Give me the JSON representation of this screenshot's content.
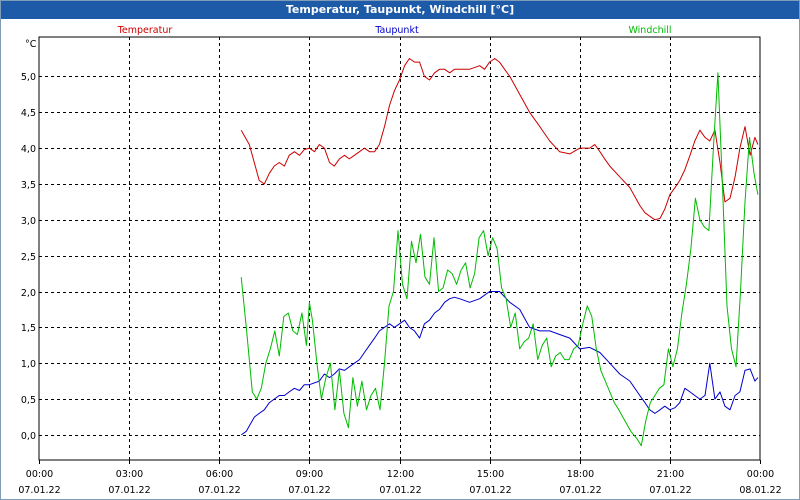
{
  "window": {
    "title": "Temperatur, Taupunkt, Windchill [°C]"
  },
  "chart_data": {
    "type": "line",
    "title": "Temperatur, Taupunkt, Windchill [°C]",
    "ylabel": "°C",
    "xlabel": "",
    "ylim": [
      -0.35,
      5.55
    ],
    "xlim_hours": [
      0,
      24
    ],
    "grid": true,
    "legend_placement": "top",
    "y_ticks": [
      "5,0",
      "4,5",
      "4,0",
      "3,5",
      "3,0",
      "2,5",
      "2,0",
      "1,5",
      "1,0",
      "0,5",
      "0,0"
    ],
    "x_ticks": [
      {
        "time": "00:00",
        "date": "07.01.22"
      },
      {
        "time": "03:00",
        "date": "07.01.22"
      },
      {
        "time": "06:00",
        "date": "07.01.22"
      },
      {
        "time": "09:00",
        "date": "07.01.22"
      },
      {
        "time": "12:00",
        "date": "07.01.22"
      },
      {
        "time": "15:00",
        "date": "07.01.22"
      },
      {
        "time": "18:00",
        "date": "07.01.22"
      },
      {
        "time": "21:00",
        "date": "07.01.22"
      },
      {
        "time": "00:00",
        "date": "08.01.22"
      }
    ],
    "series": [
      {
        "name": "Temperatur",
        "color": "#cc0000",
        "x": [
          6.73,
          7.0,
          7.33,
          7.5,
          7.67,
          7.83,
          8.0,
          8.17,
          8.33,
          8.5,
          8.67,
          8.83,
          9.0,
          9.17,
          9.33,
          9.5,
          9.67,
          9.83,
          10.0,
          10.17,
          10.33,
          10.5,
          10.67,
          10.83,
          11.0,
          11.17,
          11.33,
          11.5,
          11.67,
          11.83,
          12.0,
          12.17,
          12.33,
          12.5,
          12.67,
          12.83,
          13.0,
          13.17,
          13.33,
          13.5,
          13.67,
          13.83,
          14.0,
          14.33,
          14.67,
          14.83,
          15.0,
          15.17,
          15.33,
          15.5,
          15.67,
          16.0,
          16.33,
          16.67,
          17.0,
          17.33,
          17.67,
          18.0,
          18.33,
          18.5,
          18.67,
          18.83,
          19.0,
          19.33,
          19.67,
          20.0,
          20.17,
          20.33,
          20.5,
          20.67,
          20.83,
          21.0,
          21.17,
          21.33,
          21.5,
          21.67,
          21.83,
          22.0,
          22.17,
          22.33,
          22.5,
          22.67,
          22.83,
          23.0,
          23.17,
          23.33,
          23.5,
          23.67,
          23.83,
          23.93
        ],
        "values": [
          4.25,
          4.05,
          3.55,
          3.5,
          3.65,
          3.75,
          3.8,
          3.75,
          3.9,
          3.95,
          3.9,
          3.98,
          4.0,
          3.95,
          4.05,
          4.0,
          3.8,
          3.75,
          3.85,
          3.9,
          3.85,
          3.9,
          3.95,
          4.0,
          3.95,
          3.95,
          4.05,
          4.3,
          4.6,
          4.8,
          4.95,
          5.15,
          5.25,
          5.2,
          5.2,
          5.0,
          4.95,
          5.05,
          5.1,
          5.1,
          5.05,
          5.1,
          5.1,
          5.1,
          5.15,
          5.1,
          5.2,
          5.25,
          5.2,
          5.1,
          5.0,
          4.75,
          4.5,
          4.3,
          4.1,
          3.95,
          3.92,
          4.0,
          4.0,
          4.05,
          3.95,
          3.85,
          3.75,
          3.6,
          3.45,
          3.2,
          3.1,
          3.05,
          3.0,
          3.02,
          3.15,
          3.35,
          3.45,
          3.55,
          3.7,
          3.9,
          4.1,
          4.25,
          4.15,
          4.1,
          4.25,
          3.8,
          3.25,
          3.3,
          3.6,
          4.0,
          4.3,
          3.9,
          4.15,
          4.05
        ]
      },
      {
        "name": "Taupunkt",
        "color": "#0000cc",
        "x": [
          6.73,
          6.9,
          7.17,
          7.33,
          7.5,
          7.67,
          7.83,
          8.0,
          8.17,
          8.33,
          8.5,
          8.67,
          8.83,
          9.0,
          9.33,
          9.5,
          9.67,
          9.83,
          10.0,
          10.17,
          10.33,
          10.5,
          10.67,
          10.83,
          11.0,
          11.17,
          11.33,
          11.5,
          11.67,
          11.83,
          12.0,
          12.17,
          12.33,
          12.5,
          12.67,
          12.83,
          13.0,
          13.17,
          13.33,
          13.5,
          13.67,
          13.83,
          14.0,
          14.33,
          14.67,
          15.0,
          15.33,
          15.67,
          16.0,
          16.33,
          16.67,
          17.0,
          17.33,
          17.67,
          18.0,
          18.33,
          18.67,
          19.0,
          19.33,
          19.67,
          20.0,
          20.17,
          20.33,
          20.5,
          20.67,
          20.83,
          21.0,
          21.17,
          21.33,
          21.5,
          21.67,
          21.83,
          22.0,
          22.17,
          22.33,
          22.5,
          22.67,
          22.83,
          23.0,
          23.17,
          23.33,
          23.5,
          23.67,
          23.83,
          23.93
        ],
        "values": [
          0.0,
          0.05,
          0.25,
          0.3,
          0.35,
          0.45,
          0.5,
          0.55,
          0.55,
          0.6,
          0.65,
          0.62,
          0.7,
          0.7,
          0.75,
          0.85,
          0.8,
          0.85,
          0.92,
          0.9,
          0.95,
          1.0,
          1.05,
          1.15,
          1.25,
          1.35,
          1.45,
          1.5,
          1.55,
          1.5,
          1.55,
          1.6,
          1.5,
          1.45,
          1.35,
          1.55,
          1.6,
          1.7,
          1.75,
          1.85,
          1.9,
          1.92,
          1.9,
          1.85,
          1.9,
          2.0,
          2.0,
          1.85,
          1.75,
          1.5,
          1.45,
          1.45,
          1.4,
          1.35,
          1.2,
          1.22,
          1.15,
          1.0,
          0.85,
          0.75,
          0.55,
          0.45,
          0.35,
          0.3,
          0.35,
          0.4,
          0.35,
          0.38,
          0.45,
          0.65,
          0.6,
          0.55,
          0.5,
          0.55,
          1.0,
          0.5,
          0.6,
          0.4,
          0.35,
          0.55,
          0.6,
          0.9,
          0.92,
          0.75,
          0.8
        ]
      },
      {
        "name": "Windchill",
        "color": "#00bb00",
        "x": [
          6.73,
          6.9,
          7.1,
          7.25,
          7.4,
          7.55,
          7.7,
          7.85,
          8.0,
          8.15,
          8.3,
          8.45,
          8.6,
          8.75,
          8.9,
          9.0,
          9.1,
          9.25,
          9.4,
          9.55,
          9.7,
          9.85,
          10.0,
          10.15,
          10.3,
          10.45,
          10.6,
          10.75,
          10.9,
          11.05,
          11.2,
          11.35,
          11.5,
          11.65,
          11.8,
          11.95,
          12.1,
          12.25,
          12.4,
          12.55,
          12.7,
          12.85,
          13.0,
          13.15,
          13.3,
          13.45,
          13.6,
          13.75,
          13.9,
          14.05,
          14.2,
          14.35,
          14.5,
          14.65,
          14.8,
          14.95,
          15.1,
          15.25,
          15.4,
          15.55,
          15.7,
          15.85,
          16.0,
          16.15,
          16.3,
          16.45,
          16.6,
          16.75,
          16.9,
          17.05,
          17.2,
          17.35,
          17.5,
          17.65,
          17.8,
          17.95,
          18.1,
          18.25,
          18.4,
          18.55,
          18.7,
          18.85,
          19.0,
          19.15,
          19.3,
          19.5,
          19.7,
          19.9,
          20.05,
          20.2,
          20.35,
          20.5,
          20.65,
          20.8,
          20.95,
          21.1,
          21.25,
          21.4,
          21.55,
          21.7,
          21.85,
          22.0,
          22.15,
          22.3,
          22.45,
          22.6,
          22.75,
          22.9,
          23.05,
          23.2,
          23.35,
          23.5,
          23.65,
          23.8,
          23.93
        ],
        "values": [
          2.2,
          1.5,
          0.6,
          0.5,
          0.65,
          1.0,
          1.2,
          1.45,
          1.1,
          1.65,
          1.7,
          1.45,
          1.4,
          1.7,
          1.25,
          1.85,
          1.6,
          1.0,
          0.5,
          0.8,
          1.0,
          0.35,
          0.9,
          0.3,
          0.1,
          0.8,
          0.4,
          0.75,
          0.35,
          0.55,
          0.65,
          0.35,
          1.0,
          1.8,
          2.0,
          2.85,
          2.1,
          1.9,
          2.7,
          2.4,
          2.8,
          2.2,
          2.1,
          2.75,
          2.0,
          2.05,
          2.3,
          2.25,
          2.1,
          2.3,
          2.4,
          2.05,
          2.25,
          2.75,
          2.85,
          2.5,
          2.75,
          2.6,
          2.05,
          1.9,
          1.5,
          1.7,
          1.2,
          1.3,
          1.35,
          1.55,
          1.05,
          1.25,
          1.35,
          0.95,
          1.1,
          1.15,
          1.05,
          1.05,
          1.2,
          1.25,
          1.55,
          1.8,
          1.65,
          1.2,
          0.9,
          0.75,
          0.6,
          0.45,
          0.35,
          0.2,
          0.05,
          -0.05,
          -0.15,
          0.2,
          0.45,
          0.55,
          0.65,
          0.7,
          1.2,
          0.95,
          1.2,
          1.7,
          2.1,
          2.6,
          3.3,
          3.0,
          2.9,
          2.85,
          4.0,
          5.05,
          3.5,
          1.8,
          1.2,
          0.95,
          2.0,
          3.25,
          4.15,
          3.65,
          3.35
        ]
      }
    ]
  }
}
